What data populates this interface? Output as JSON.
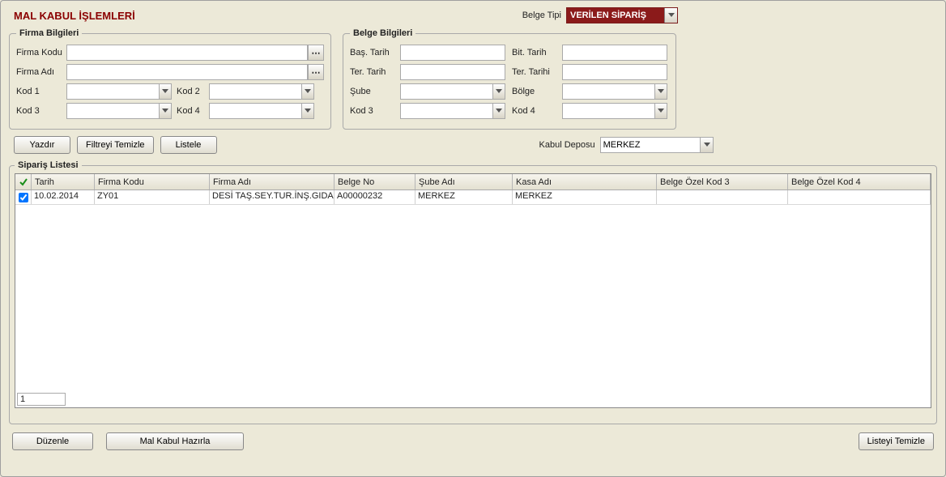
{
  "header": {
    "title": "MAL KABUL İŞLEMLERİ",
    "belge_tipi_label": "Belge Tipi",
    "belge_tipi_value": "VERİLEN SİPARİŞ"
  },
  "firma": {
    "legend": "Firma Bilgileri",
    "firma_kodu_label": "Firma Kodu",
    "firma_kodu_value": "",
    "firma_adi_label": "Firma Adı",
    "firma_adi_value": "",
    "kod1_label": "Kod 1",
    "kod1_value": "",
    "kod2_label": "Kod 2",
    "kod2_value": "",
    "kod3_label": "Kod 3",
    "kod3_value": "",
    "kod4_label": "Kod 4",
    "kod4_value": ""
  },
  "belge": {
    "legend": "Belge Bilgileri",
    "bas_tarih_label": "Baş. Tarih",
    "bas_tarih_value": "",
    "bit_tarih_label": "Bit. Tarih",
    "bit_tarih_value": "",
    "ter_tarih_label": "Ter. Tarih",
    "ter_tarih_value": "",
    "ter_tarihi_label": "Ter. Tarihi",
    "ter_tarihi_value": "",
    "sube_label": "Şube",
    "sube_value": "",
    "bolge_label": "Bölge",
    "bolge_value": "",
    "kod3_label": "Kod 3",
    "kod3_value": "",
    "kod4_label": "Kod 4",
    "kod4_value": ""
  },
  "actions": {
    "yazdir": "Yazdır",
    "filtreyi_temizle": "Filtreyi Temizle",
    "listele": "Listele",
    "kabul_deposu_label": "Kabul Deposu",
    "kabul_deposu_value": "MERKEZ"
  },
  "list": {
    "legend": "Sipariş Listesi",
    "columns": {
      "tarih": "Tarih",
      "firma_kodu": "Firma Kodu",
      "firma_adi": "Firma Adı",
      "belge_no": "Belge No",
      "sube_adi": "Şube Adı",
      "kasa_adi": "Kasa Adı",
      "ozel_kod3": "Belge Özel Kod 3",
      "ozel_kod4": "Belge Özel Kod 4"
    },
    "rows": [
      {
        "checked": true,
        "tarih": "10.02.2014",
        "firma_kodu": "ZY01",
        "firma_adi": "DESİ TAŞ.SEY.TUR.İNŞ.GIDA",
        "belge_no": "A00000232",
        "sube_adi": "MERKEZ",
        "kasa_adi": "MERKEZ",
        "ozel_kod3": "",
        "ozel_kod4": ""
      }
    ],
    "footer_count": "1"
  },
  "bottom": {
    "duzenle": "Düzenle",
    "mal_kabul": "Mal Kabul Hazırla",
    "listeyi_temizle": "Listeyi Temizle"
  }
}
